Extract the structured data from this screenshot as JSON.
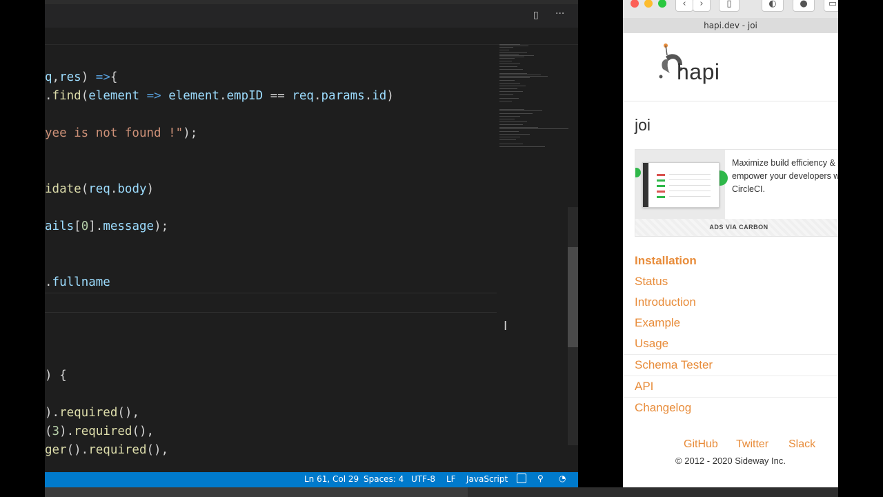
{
  "editor": {
    "code_lines": [
      {
        "segments": [
          [
            "q",
            "var"
          ],
          [
            ",",
            "op"
          ],
          [
            "res",
            "var"
          ],
          [
            ") ",
            "op"
          ],
          [
            "=>",
            "arrow"
          ],
          [
            "{",
            "op"
          ]
        ]
      },
      {
        "segments": [
          [
            ".",
            "op"
          ],
          [
            "find",
            "fn"
          ],
          [
            "(",
            "op"
          ],
          [
            "element",
            "var"
          ],
          [
            " ",
            "op"
          ],
          [
            "=>",
            "arrow"
          ],
          [
            " ",
            "op"
          ],
          [
            "element",
            "var"
          ],
          [
            ".",
            "op"
          ],
          [
            "empID",
            "var"
          ],
          [
            " == ",
            "op"
          ],
          [
            "req",
            "var"
          ],
          [
            ".",
            "op"
          ],
          [
            "params",
            "var"
          ],
          [
            ".",
            "op"
          ],
          [
            "id",
            "var"
          ],
          [
            ")",
            "op"
          ]
        ]
      },
      {
        "segments": [
          [
            "yee is not found !\"",
            "str"
          ],
          [
            ");",
            "op"
          ]
        ]
      },
      {
        "segments": [
          [
            "idate",
            "fn"
          ],
          [
            "(",
            "op"
          ],
          [
            "req",
            "var"
          ],
          [
            ".",
            "op"
          ],
          [
            "body",
            "var"
          ],
          [
            ")",
            "op"
          ]
        ]
      },
      {
        "segments": [
          [
            "ails",
            "var"
          ],
          [
            "[",
            "op"
          ],
          [
            "0",
            "num"
          ],
          [
            "].",
            "op"
          ],
          [
            "message",
            "var"
          ],
          [
            ");",
            "op"
          ]
        ]
      },
      {
        "segments": [
          [
            ".",
            "op"
          ],
          [
            "fullname",
            "var"
          ]
        ]
      },
      {
        "segments": [
          [
            ") {",
            "op"
          ]
        ]
      },
      {
        "segments": [
          [
            ").",
            "op"
          ],
          [
            "required",
            "fn"
          ],
          [
            "(),",
            "op"
          ]
        ]
      },
      {
        "segments": [
          [
            "(",
            "op"
          ],
          [
            "3",
            "num"
          ],
          [
            ").",
            "op"
          ],
          [
            "required",
            "fn"
          ],
          [
            "(),",
            "op"
          ]
        ]
      },
      {
        "segments": [
          [
            "ger",
            "fn"
          ],
          [
            "().",
            "op"
          ],
          [
            "required",
            "fn"
          ],
          [
            "(),",
            "op"
          ]
        ]
      }
    ],
    "toolbar_icons": [
      "split-editor-icon",
      "more-actions-icon"
    ],
    "toolbar_glyphs": {
      "split": "▯",
      "more": "···"
    }
  },
  "statusbar": {
    "position": "Ln 61, Col 29",
    "spaces": "Spaces: 4",
    "encoding": "UTF-8",
    "eol": "LF",
    "language": "JavaScript"
  },
  "browser": {
    "window_title": "hapi.dev - joi",
    "logo_text": "hapi",
    "page_title": "joi",
    "ad": {
      "text": "Maximize build efficiency & empower your developers with CircleCI.",
      "footer": "ADS VIA CARBON"
    },
    "nav": [
      {
        "label": "Installation",
        "bold": true
      },
      {
        "label": "Status"
      },
      {
        "label": "Introduction"
      },
      {
        "label": "Example"
      },
      {
        "label": "Usage"
      },
      {
        "label": "Schema Tester"
      },
      {
        "label": "API"
      },
      {
        "label": "Changelog"
      }
    ],
    "footer_links": [
      "GitHub",
      "Twitter",
      "Slack"
    ],
    "copyright": "© 2012 - 2020 Sideway Inc."
  },
  "colors": {
    "accent": "#e88c3a",
    "statusbar": "#007acc",
    "editor_bg": "#1e1e1e"
  }
}
